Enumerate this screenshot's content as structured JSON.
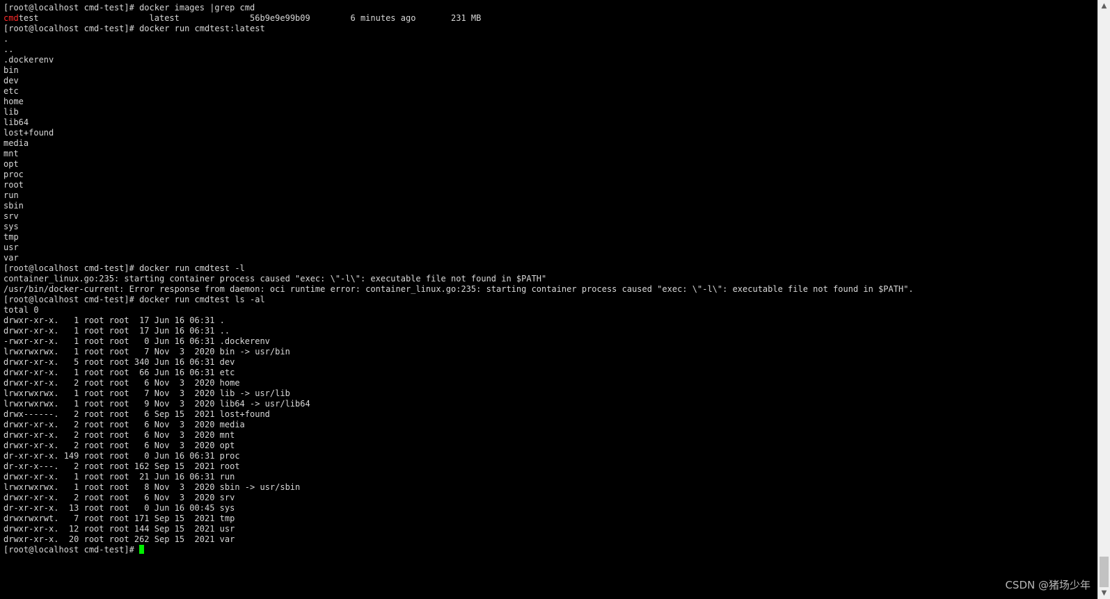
{
  "terminal": {
    "lines": [
      "[root@localhost cmd-test]# docker images |grep cmd",
      "",
      "[root@localhost cmd-test]# docker run cmdtest:latest",
      ".",
      "..",
      ".dockerenv",
      "bin",
      "dev",
      "etc",
      "home",
      "lib",
      "lib64",
      "lost+found",
      "media",
      "mnt",
      "opt",
      "proc",
      "root",
      "run",
      "sbin",
      "srv",
      "sys",
      "tmp",
      "usr",
      "var",
      "[root@localhost cmd-test]# docker run cmdtest -l",
      "container_linux.go:235: starting container process caused \"exec: \\\"-l\\\": executable file not found in $PATH\"",
      "/usr/bin/docker-current: Error response from daemon: oci runtime error: container_linux.go:235: starting container process caused \"exec: \\\"-l\\\": executable file not found in $PATH\".",
      "[root@localhost cmd-test]# docker run cmdtest ls -al",
      "total 0",
      "drwxr-xr-x.   1 root root  17 Jun 16 06:31 .",
      "drwxr-xr-x.   1 root root  17 Jun 16 06:31 ..",
      "-rwxr-xr-x.   1 root root   0 Jun 16 06:31 .dockerenv",
      "lrwxrwxrwx.   1 root root   7 Nov  3  2020 bin -> usr/bin",
      "drwxr-xr-x.   5 root root 340 Jun 16 06:31 dev",
      "drwxr-xr-x.   1 root root  66 Jun 16 06:31 etc",
      "drwxr-xr-x.   2 root root   6 Nov  3  2020 home",
      "lrwxrwxrwx.   1 root root   7 Nov  3  2020 lib -> usr/lib",
      "lrwxrwxrwx.   1 root root   9 Nov  3  2020 lib64 -> usr/lib64",
      "drwx------.   2 root root   6 Sep 15  2021 lost+found",
      "drwxr-xr-x.   2 root root   6 Nov  3  2020 media",
      "drwxr-xr-x.   2 root root   6 Nov  3  2020 mnt",
      "drwxr-xr-x.   2 root root   6 Nov  3  2020 opt",
      "dr-xr-xr-x. 149 root root   0 Jun 16 06:31 proc",
      "dr-xr-x---.   2 root root 162 Sep 15  2021 root",
      "drwxr-xr-x.   1 root root  21 Jun 16 06:31 run",
      "lrwxrwxrwx.   1 root root   8 Nov  3  2020 sbin -> usr/sbin",
      "drwxr-xr-x.   2 root root   6 Nov  3  2020 srv",
      "dr-xr-xr-x.  13 root root   0 Jun 16 00:45 sys",
      "drwxrwxrwt.   7 root root 171 Sep 15  2021 tmp",
      "drwxr-xr-x.  12 root root 144 Sep 15  2021 usr",
      "drwxr-xr-x.  20 root root 262 Sep 15  2021 var",
      ""
    ],
    "image_row": {
      "repo_highlight": "cmd",
      "repo_rest": "test                      latest              56b9e9e99b09        6 minutes ago       231 MB"
    },
    "prompt": "[root@localhost cmd-test]# "
  },
  "scrollbar": {
    "up_glyph": "▲",
    "down_glyph": "▼",
    "position_fraction": 1.0
  },
  "watermark": {
    "text": "CSDN @猪场少年"
  },
  "colors": {
    "background": "#000000",
    "foreground": "#d8d8d8",
    "highlight": "#ff2a2a",
    "cursor": "#00ee00"
  }
}
